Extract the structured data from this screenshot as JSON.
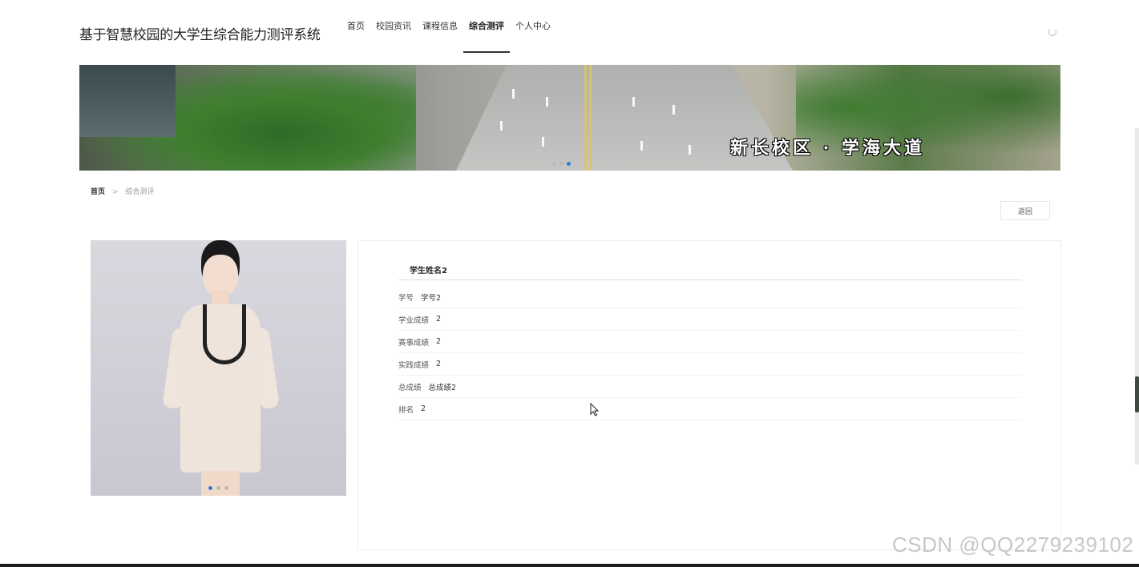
{
  "header": {
    "site_title": "基于智慧校园的大学生综合能力测评系统",
    "nav": [
      {
        "label": "首页"
      },
      {
        "label": "校园资讯"
      },
      {
        "label": "课程信息"
      },
      {
        "label": "综合测评"
      },
      {
        "label": "个人中心"
      }
    ],
    "active_nav_index": 3
  },
  "banner": {
    "caption": "新长校区 · 学海大道",
    "slide_count": 3,
    "active_slide": 2
  },
  "breadcrumb": {
    "home": "首页",
    "separator": ">",
    "current": "综合测评"
  },
  "actions": {
    "back_label": "返回"
  },
  "photo": {
    "slide_count": 3,
    "active_slide": 0
  },
  "detail": {
    "student_name": "学生姓名2",
    "fields": [
      {
        "label": "学号",
        "value": "学号2"
      },
      {
        "label": "学业成绩",
        "value": "2"
      },
      {
        "label": "赛事成绩",
        "value": "2"
      },
      {
        "label": "实践成绩",
        "value": "2"
      },
      {
        "label": "总成绩",
        "value": "总成绩2"
      },
      {
        "label": "排名",
        "value": "2"
      }
    ]
  },
  "watermark": "CSDN @QQ2279239102",
  "colors": {
    "accent_blue": "#2f7cd6",
    "nav_underline": "#333333"
  }
}
